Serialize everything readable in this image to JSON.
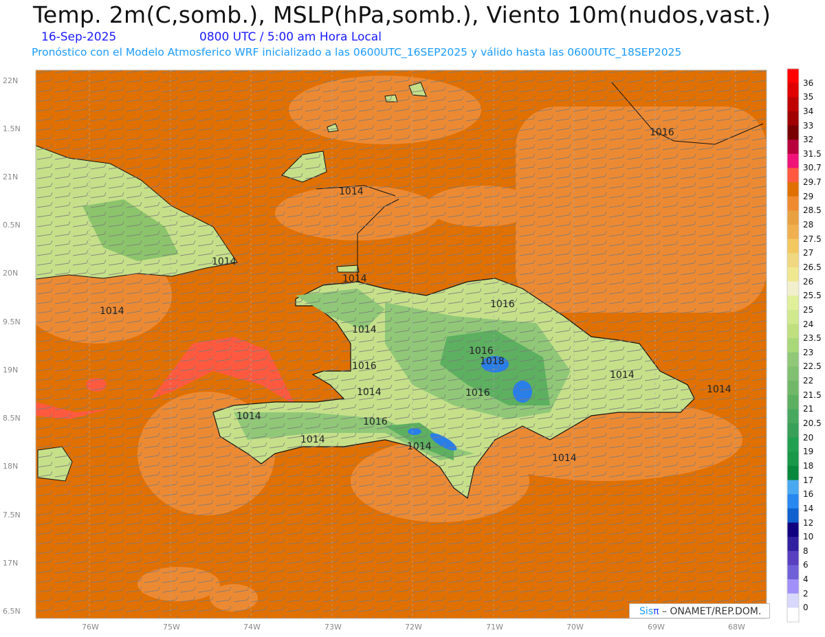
{
  "header": {
    "title": "Temp. 2m(C,somb.), MSLP(hPa,somb.), Viento 10m(nudos,vast.)",
    "date": "16-Sep-2025",
    "time": "0800 UTC / 5:00 am Hora Local",
    "forecast_note": "Pronóstico con el Modelo Atmosferico WRF inicializado a las 0600UTC_16SEP2025 y válido hasta las  0600UTC_18SEP2025"
  },
  "map": {
    "lat_labels": [
      "22N",
      "1.5N",
      "21N",
      "0.5N",
      "20N",
      "9.5N",
      "19N",
      "8.5N",
      "18N",
      "7.5N",
      "17N",
      "6.5N"
    ],
    "lon_labels": [
      "76W",
      "75W",
      "74W",
      "73W",
      "72W",
      "71W",
      "70W",
      "69W",
      "68W"
    ],
    "pressure_labels": [
      "1016",
      "1014",
      "1014",
      "1014",
      "1014",
      "1014",
      "1016",
      "1016",
      "1016",
      "1018",
      "1014",
      "1014",
      "1016",
      "1014",
      "1016",
      "1014",
      "1014",
      "1014",
      "1014"
    ],
    "colors": {
      "ocean": "#e07000",
      "warm": "#f0903a",
      "light": "#f4b068",
      "land": "#c6e08a",
      "green": "#5cb060",
      "blue": "#2a7ee8",
      "red": "#ff5a40"
    }
  },
  "colorbar": {
    "labels": [
      "36",
      "35",
      "34",
      "33",
      "32",
      "31.5",
      "30.7",
      "29.7",
      "29",
      "28.5",
      "28",
      "27.5",
      "27",
      "26.5",
      "26",
      "25.5",
      "25",
      "24",
      "23.5",
      "23",
      "22.5",
      "22",
      "21.5",
      "21",
      "20.5",
      "20",
      "19",
      "18",
      "17",
      "16",
      "14",
      "12",
      "10",
      "8",
      "6",
      "4",
      "2",
      "0"
    ],
    "colors": [
      "#ff0000",
      "#e00000",
      "#c00000",
      "#a00000",
      "#780000",
      "#b8003c",
      "#f01478",
      "#ff5a40",
      "#e07000",
      "#f08a30",
      "#e8a040",
      "#f0b050",
      "#f4c860",
      "#f0d880",
      "#f0e890",
      "#f2f0cc",
      "#e0f09a",
      "#d0e88e",
      "#c0e080",
      "#a8d878",
      "#90c878",
      "#80c070",
      "#70b868",
      "#5cb060",
      "#48a860",
      "#38a058",
      "#20a050",
      "#189848",
      "#08883c",
      "#4aa8f0",
      "#2888f0",
      "#1060d0",
      "#100080",
      "#3020a0",
      "#5840c0",
      "#7060d8",
      "#a090f8",
      "#d8d8fc",
      "#ffffff"
    ]
  },
  "credit": {
    "sis": "Sis",
    "pi": "π",
    "text": " –  ONAMET/REP.DOM."
  }
}
